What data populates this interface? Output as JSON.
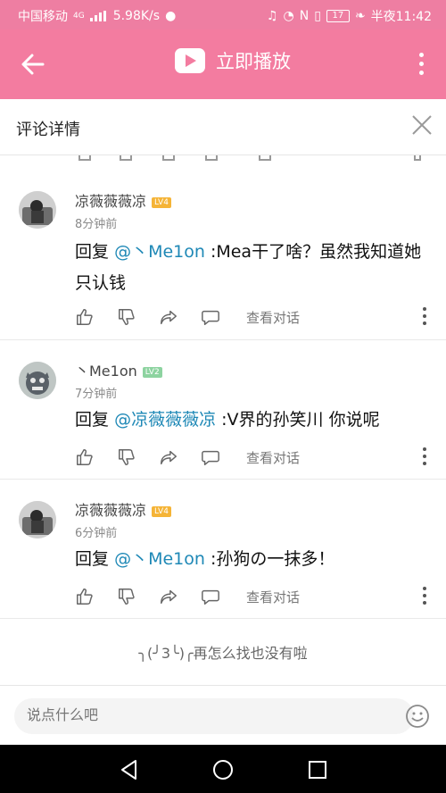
{
  "status": {
    "carrier": "中国移动",
    "network": "4G",
    "speed": "5.98K/s",
    "battery": "17",
    "time": "半夜11:42"
  },
  "appbar": {
    "title": "立即播放"
  },
  "header": {
    "title": "评论详情"
  },
  "comments": [
    {
      "name": "凉薇薇薇凉",
      "level": "LV4",
      "time": "8分钟前",
      "reply_prefix": "回复",
      "mention": "@丶Me1on",
      "text": ":Mea干了啥？虽然我知道她只认钱",
      "conv": "查看对话"
    },
    {
      "name": "丶Me1on",
      "level": "LV2",
      "time": "7分钟前",
      "reply_prefix": "回复",
      "mention": "@凉薇薇薇凉",
      "text": ":V界的孙笑川 你说呢",
      "conv": "查看对话"
    },
    {
      "name": "凉薇薇薇凉",
      "level": "LV4",
      "time": "6分钟前",
      "reply_prefix": "回复",
      "mention": "@丶Me1on",
      "text": ":孙狗の一抹多！",
      "conv": "查看对话"
    }
  ],
  "end_text": "╮(╯3╰)╭再怎么找也没有啦",
  "input": {
    "placeholder": "说点什么吧"
  },
  "colors": {
    "accent": "#f37ca0",
    "mention": "#1e88b6",
    "lv4": "#f5b437",
    "lv2": "#8dd3a0"
  }
}
